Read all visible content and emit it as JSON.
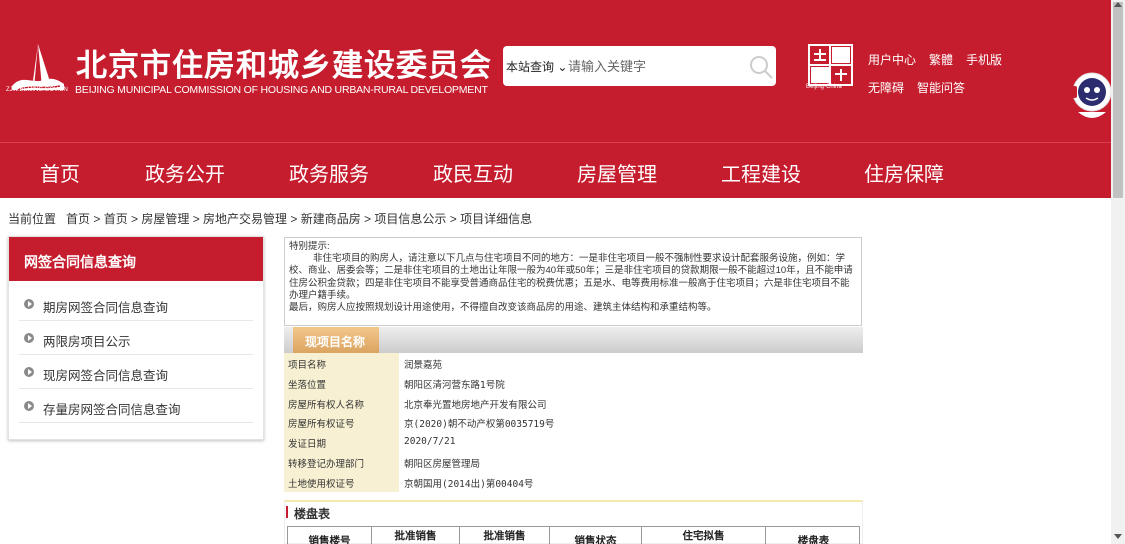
{
  "header": {
    "site_title": "北京市住房和城乡建设委员会",
    "site_subtitle": "BEIJING MUNICIPAL COMMISSION OF HOUSING AND URBAN-RURAL DEVELOPMENT",
    "logo_domain": "ZJW.BEIJING.GOV.CN",
    "search_scope": "本站查询",
    "search_placeholder": "请输入关键字",
    "capital_label": "Beijing·China",
    "links": [
      "用户中心",
      "繁體",
      "手机版",
      "无障碍",
      "智能问答"
    ]
  },
  "nav": [
    "首页",
    "政务公开",
    "政务服务",
    "政民互动",
    "房屋管理",
    "工程建设",
    "住房保障"
  ],
  "breadcrumb": {
    "label": "当前位置",
    "path": "首页 > 首页 > 房屋管理 > 房地产交易管理 > 新建商品房 > 项目信息公示 > 项目详细信息"
  },
  "sidebar": {
    "title": "网签合同信息查询",
    "items": [
      "期房网签合同信息查询",
      "两限房项目公示",
      "现房网签合同信息查询",
      "存量房网签合同信息查询"
    ]
  },
  "notice": {
    "heading": "特别提示:",
    "body": "非住宅项目的购房人，请注意以下几点与住宅项目不同的地方：一是非住宅项目一般不强制性要求设计配套服务设施，例如：学校、商业、居委会等；二是非住宅项目的土地出让年限一般为40年或50年；三是非住宅项目的贷款期限一般不能超过10年，且不能申请住房公积金贷款；四是非住宅项目不能享受普通商品住宅的税费优惠；五是水、电等费用标准一般高于住宅项目；六是非住宅项目不能办理户籍手续。",
    "last": "最后，购房人应按照规划设计用途使用，不得擅自改变该商品房的用途、建筑主体结构和承重结构等。"
  },
  "detail": {
    "section_title": "现项目名称",
    "rows": [
      {
        "label": "项目名称",
        "value": "润景嘉苑"
      },
      {
        "label": "坐落位置",
        "value": "朝阳区清河营东路1号院"
      },
      {
        "label": "房屋所有权人名称",
        "value": "北京奉光置地房地产开发有限公司"
      },
      {
        "label": "房屋所有权证号",
        "value": "京(2020)朝不动产权第0035719号"
      },
      {
        "label": "发证日期",
        "value": "2020/7/21"
      },
      {
        "label": "转移登记办理部门",
        "value": "朝阳区房屋管理局"
      },
      {
        "label": "土地使用权证号",
        "value": "京朝国用(2014出)第00404号"
      }
    ]
  },
  "building_table": {
    "title": "楼盘表",
    "columns": [
      "销售楼号",
      "批准销售",
      "批准销售",
      "销售状态",
      "住宅拟售",
      "楼盘表"
    ]
  },
  "colors": {
    "brand_red": "#c61d2e",
    "label_bg": "#f7f0d2",
    "tab_orange": "#dba460"
  }
}
